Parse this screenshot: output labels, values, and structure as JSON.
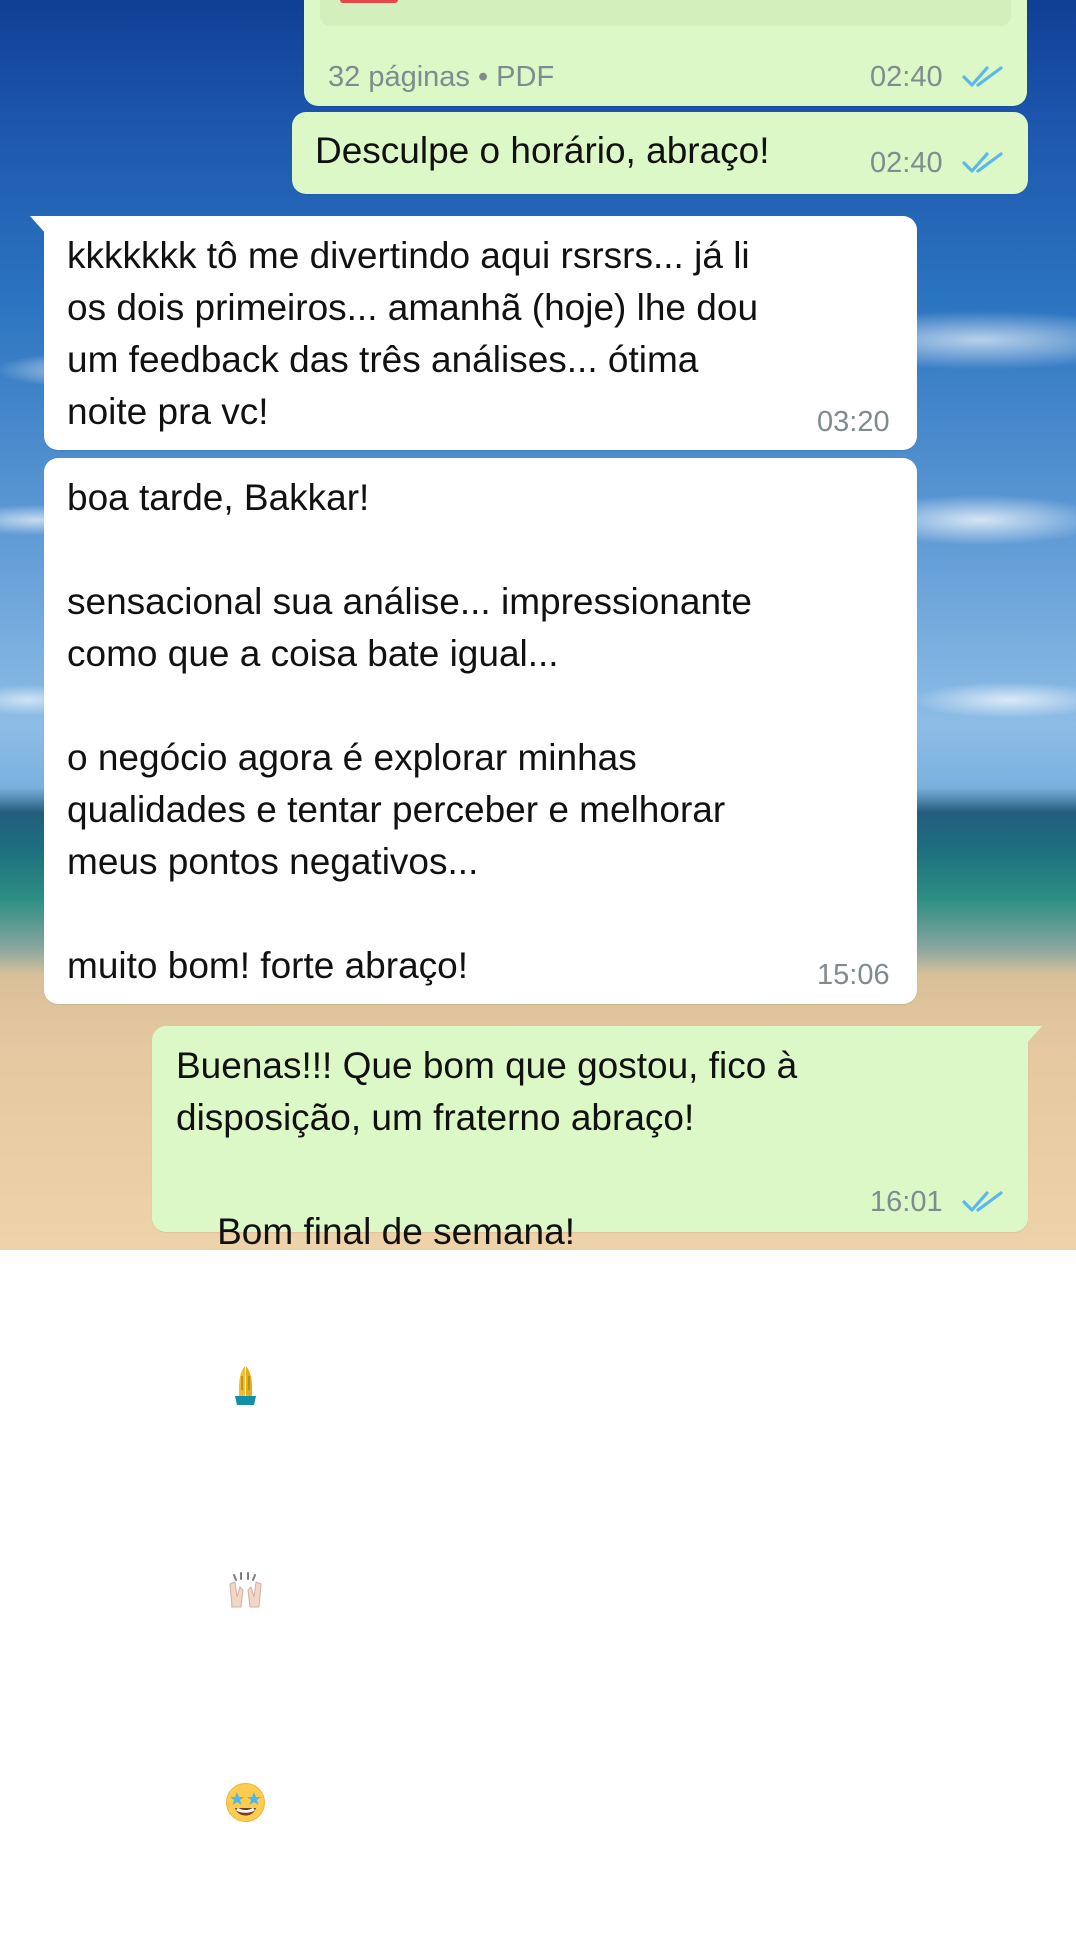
{
  "colors": {
    "outgoing_bubble": "#dcf8c6",
    "incoming_bubble": "#ffffff",
    "meta_text": "#7f8b8f",
    "read_ticks": "#5bb7ec"
  },
  "messages": [
    {
      "direction": "outgoing",
      "type": "document",
      "document_meta": "32 páginas • PDF",
      "time": "02:40",
      "status_icon": "double-check-read-icon"
    },
    {
      "direction": "outgoing",
      "type": "text",
      "text": "Desculpe o horário, abraço!",
      "time": "02:40",
      "status_icon": "double-check-read-icon"
    },
    {
      "direction": "incoming",
      "type": "text",
      "text": "kkkkkkk tô me divertindo aqui rsrsrs... já li\nos dois primeiros... amanhã (hoje) lhe dou\num feedback das três análises... ótima\nnoite pra vc!",
      "time": "03:20"
    },
    {
      "direction": "incoming",
      "type": "text",
      "text": "boa tarde, Bakkar!\n\nsensacional sua análise... impressionante\ncomo que a coisa bate igual...\n\no negócio agora é explorar minhas\nqualidades e tentar perceber e melhorar\nmeus pontos negativos...\n\nmuito bom! forte abraço!",
      "time": "15:06"
    },
    {
      "direction": "outgoing",
      "type": "text",
      "text_line_1": "Buenas!!! Que bom que gostou, fico à",
      "text_line_2": "disposição, um fraterno abraço!",
      "text_line_3": "Bom final de semana!",
      "emojis": [
        "folded-hands-icon",
        "raising-hands-icon",
        "star-struck-icon"
      ],
      "time": "16:01",
      "status_icon": "double-check-read-icon"
    }
  ]
}
